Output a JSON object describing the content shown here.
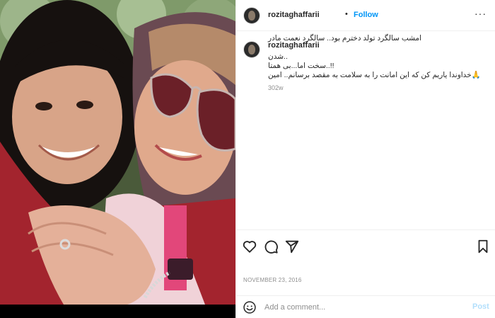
{
  "header": {
    "username": "rozitaghaffarii",
    "separator": "•",
    "follow_label": "Follow",
    "more_label": "···"
  },
  "caption": {
    "username": "rozitaghaffarii",
    "lines": [
      "امشب سالگرد تولد دخترم بود.. سالگرد نعمت مادر",
      "..شدن",
      "!!..سخت اما...بی همتا",
      "🙏خداوندا یاریم کن که این امانت را به سلامت به مقصد برسانم.. امین"
    ],
    "time": "302w"
  },
  "actions": {
    "like_icon": "heart-icon",
    "comment_icon": "comment-icon",
    "share_icon": "paper-plane-icon",
    "save_icon": "bookmark-icon",
    "date": "NOVEMBER 23, 2016"
  },
  "comment_box": {
    "placeholder": "Add a comment...",
    "post_label": "Post",
    "emoji_icon": "smiley-icon"
  },
  "colors": {
    "accent": "#0095f6",
    "post_disabled": "#b2dffc",
    "secondary_text": "#8e8e8e",
    "divider": "#efefef"
  }
}
